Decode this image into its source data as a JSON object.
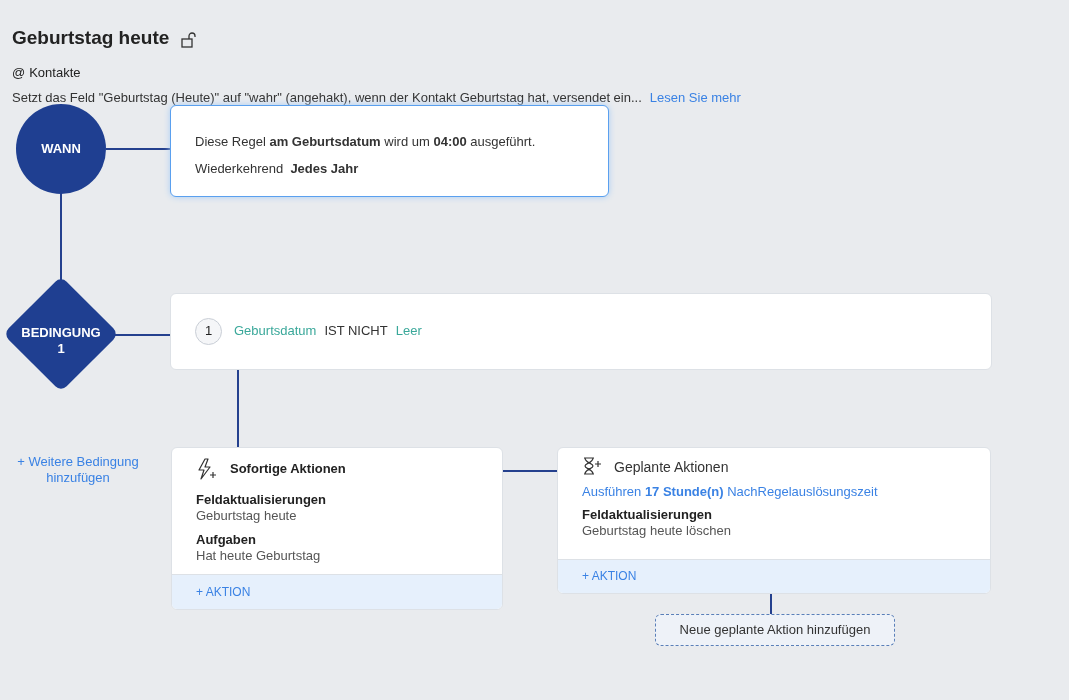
{
  "header": {
    "title": "Geburtstag heute",
    "module_symbol": "@",
    "module": "Kontakte",
    "description": "Setzt das Feld \"Geburtstag (Heute)\" auf \"wahr\" (angehakt), wenn der Kontakt Geburtstag hat, versendet ein...",
    "read_more": "Lesen Sie mehr"
  },
  "trigger": {
    "label": "WANN",
    "text": "Diese Regel **am Geburtsdatum** wird um **04:00** ausgeführt.",
    "recurrence": "Wiederkehrend  **Jedes Jahr**"
  },
  "condition": {
    "label": "BEDINGUNG 1",
    "number": "1",
    "field": "Geburtsdatum",
    "operator": "IST NICHT",
    "value": "Leer"
  },
  "add_condition": "+ Weitere Bedingung hinzufügen",
  "instant_actions": {
    "title": "Sofortige Aktionen",
    "groups": [
      {
        "heading": "Feldaktualisierungen",
        "value": "Geburtstag heute"
      },
      {
        "heading": "Aufgaben",
        "value": "Hat heute Geburtstag"
      }
    ],
    "add_action": "+ AKTION"
  },
  "scheduled_actions": {
    "title": "Geplante Aktionen",
    "schedule": "Ausführen **17 Stunde(n)** NachRegelauslösungszeit",
    "groups": [
      {
        "heading": "Feldaktualisierungen",
        "value": "Geburtstag heute löschen"
      }
    ],
    "add_action": "+ AKTION"
  },
  "add_scheduled_action": "Neue geplante Aktion hinzufügen"
}
